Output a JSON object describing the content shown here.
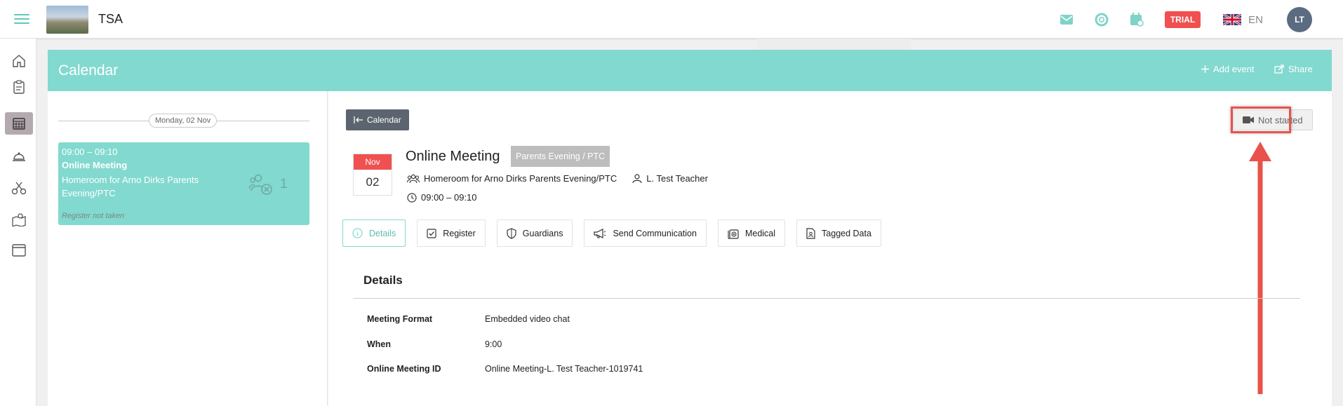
{
  "topbar": {
    "app_name": "TSA",
    "trial_label": "TRIAL",
    "language": "EN",
    "avatar_initials": "LT"
  },
  "calendar": {
    "title": "Calendar",
    "add_event": "Add event",
    "share": "Share"
  },
  "event_list": {
    "date_label": "Monday, 02 Nov",
    "card": {
      "time": "09:00 – 09:10",
      "title": "Online Meeting",
      "group": "Homeroom for Arno Dirks Parents Evening/PTC",
      "count": "1",
      "register_status": "Register not taken"
    }
  },
  "event": {
    "back_label": "Calendar",
    "status_label": "Not started",
    "month": "Nov",
    "day": "02",
    "title": "Online Meeting",
    "type_badge": "Parents Evening / PTC",
    "group": "Homeroom for Arno Dirks Parents Evening/PTC",
    "teacher": "L. Test Teacher",
    "time": "09:00 – 09:10"
  },
  "tabs": [
    {
      "label": "Details"
    },
    {
      "label": "Register"
    },
    {
      "label": "Guardians"
    },
    {
      "label": "Send Communication"
    },
    {
      "label": "Medical"
    },
    {
      "label": "Tagged Data"
    }
  ],
  "details": {
    "heading": "Details",
    "rows": [
      {
        "key": "Meeting Format",
        "value": "Embedded video chat"
      },
      {
        "key": "When",
        "value": "9:00"
      },
      {
        "key": "Online Meeting ID",
        "value": "Online Meeting-L. Test Teacher-1019741"
      }
    ]
  },
  "colors": {
    "accent": "#82d9cf",
    "accent_dark": "#5cbdb2",
    "trial": "#f05050",
    "highlight": "#e8524a"
  }
}
